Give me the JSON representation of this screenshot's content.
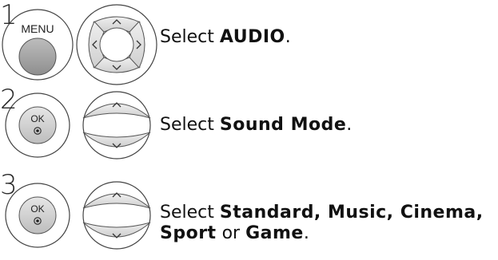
{
  "steps": [
    {
      "number": "1",
      "button_label": "MENU",
      "text_prefix": "Select ",
      "text_bold": "AUDIO",
      "text_suffix": "."
    },
    {
      "number": "2",
      "button_label": "OK",
      "text_prefix": "Select ",
      "text_bold": "Sound Mode",
      "text_suffix": "."
    },
    {
      "number": "3",
      "button_label": "OK",
      "line1_prefix": "Select ",
      "line1_bold": "Standard, Music, Cinema,",
      "line2_bold_1": "Sport",
      "line2_mid": " or ",
      "line2_bold_2": "Game",
      "line2_suffix": "."
    }
  ],
  "icons": {
    "arrow_up": "chevron-up-icon",
    "arrow_down": "chevron-down-icon",
    "arrow_left": "chevron-left-icon",
    "arrow_right": "chevron-right-icon",
    "ok_dot": "ok-dot-icon"
  }
}
